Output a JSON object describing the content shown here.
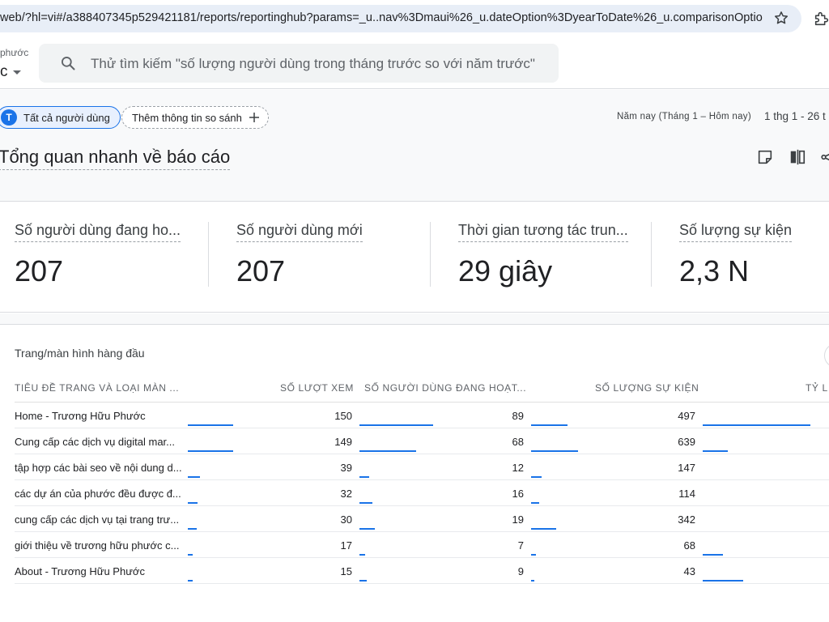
{
  "browser": {
    "url_main": "web/?hl=vi#/a388407345p529421181/reports/reportinghub?params=_u..nav%3Dmaui%26_u.dateOption%3DyearToDate%26_u.comparisonOption%3D..."
  },
  "header": {
    "account_small": "phước",
    "account_big": "c",
    "search_placeholder": "Thử tìm kiếm \"số lượng người dùng trong tháng trước so với năm trước\""
  },
  "filters": {
    "all_users_initial": "T",
    "all_users_label": "Tất cả người dùng",
    "compare_label": "Thêm thông tin so sánh",
    "date_range_label": "Năm nay (Tháng 1 – Hôm nay)",
    "date_range_value": "1 thg 1 - 26 t"
  },
  "page": {
    "title": "Tổng quan nhanh về báo cáo"
  },
  "kpis": [
    {
      "label": "Số người dùng đang ho...",
      "value": "207"
    },
    {
      "label": "Số người dùng mới",
      "value": "207"
    },
    {
      "label": "Thời gian tương tác trun...",
      "value": "29 giây"
    },
    {
      "label": "Số lượng sự kiện",
      "value": "2,3 N"
    }
  ],
  "table": {
    "title": "Trang/màn hình hàng đầu",
    "headers": {
      "name": "TIÊU ĐỀ TRANG VÀ LOẠI MÀN ...",
      "views": "SỐ LƯỢT XEM",
      "active_users": "SỐ NGƯỜI DÙNG ĐANG HOẠT...",
      "events": "SỐ LƯỢNG SỰ KIỆN",
      "rate": "TỶ L"
    },
    "max": {
      "views": 150,
      "active_users": 89,
      "events": 639
    },
    "rows": [
      {
        "name": "Home - Trương Hữu Phước",
        "views": "150",
        "active_users": "89",
        "events": "497",
        "rate_fraction": 0.85
      },
      {
        "name": "Cung cấp các dịch vụ digital mar...",
        "views": "149",
        "active_users": "68",
        "events": "639",
        "rate_fraction": 0.2
      },
      {
        "name": "tập hợp các bài seo về nội dung d...",
        "views": "39",
        "active_users": "12",
        "events": "147",
        "rate_fraction": 0
      },
      {
        "name": "các dự án của phước đều được đ...",
        "views": "32",
        "active_users": "16",
        "events": "114",
        "rate_fraction": 0
      },
      {
        "name": "cung cấp các dịch vụ tại trang trư...",
        "views": "30",
        "active_users": "19",
        "events": "342",
        "rate_fraction": 0
      },
      {
        "name": "giới thiệu về trương hữu phước c...",
        "views": "17",
        "active_users": "7",
        "events": "68",
        "rate_fraction": 0.16
      },
      {
        "name": "About - Trương Hữu Phước",
        "views": "15",
        "active_users": "9",
        "events": "43",
        "rate_fraction": 0.32
      }
    ]
  },
  "colors": {
    "accent": "#1a73e8",
    "chip_bg": "#e8f0fe"
  },
  "icons": {
    "search": "search-icon",
    "star": "star-icon",
    "extensions": "puzzle-icon",
    "notes": "note-icon",
    "compare_columns": "columns-icon",
    "share": "share-icon",
    "plus": "plus-icon"
  }
}
